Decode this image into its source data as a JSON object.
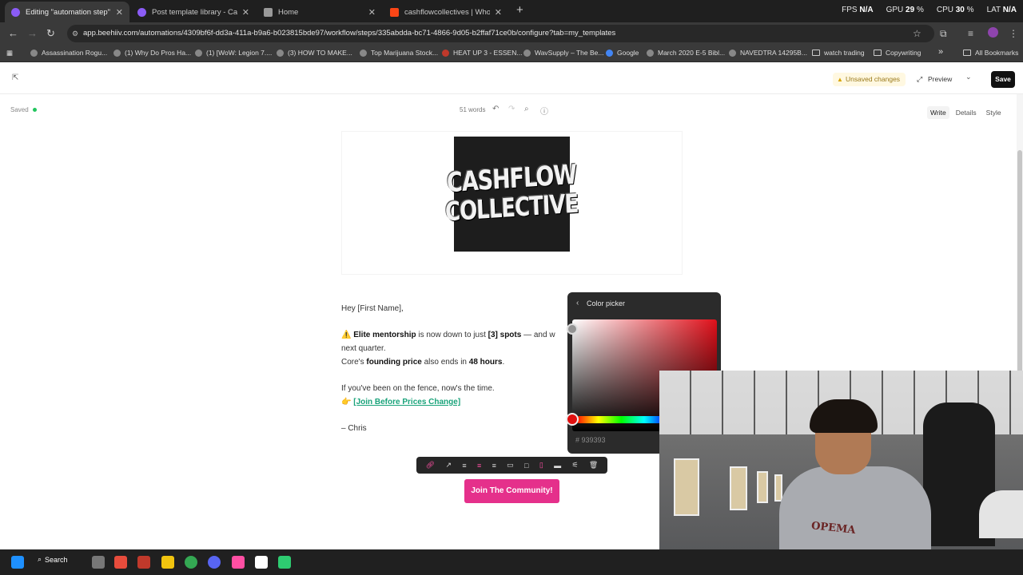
{
  "browser": {
    "tabs": [
      {
        "title": "Editing \"automation step\"",
        "active": true,
        "icon": "beehiiv-icon"
      },
      {
        "title": "Post template library - Cashflo...",
        "active": false,
        "icon": "beehiiv-icon"
      },
      {
        "title": "Home",
        "active": false,
        "icon": "page-icon"
      },
      {
        "title": "cashflowcollectives | Whop",
        "active": false,
        "icon": "whop-icon"
      }
    ],
    "new_tab": "+",
    "url": "app.beehiiv.com/automations/4309bf6f-dd3a-411a-b9a6-b023815bde97/workflow/steps/335abdda-bc71-4866-9d05-b2ffaf71ce0b/configure?tab=my_templates",
    "perf": {
      "fps_label": "FPS",
      "fps": "N/A",
      "gpu_label": "GPU",
      "gpu": "29",
      "cpu_label": "CPU",
      "cpu": "30",
      "lat_label": "LAT",
      "lat": "N/A",
      "pct": "%"
    },
    "bookmarks": [
      "Assassination Rogu...",
      "(1) Why Do Pros Ha...",
      "(1) [WoW: Legion 7....",
      "(3) HOW TO MAKE...",
      "Top Marijuana Stock...",
      "HEAT UP 3 - ESSEN...",
      "WavSupply – The Be...",
      "Google",
      "March 2020 E-5 Bibl...",
      "NAVEDTRA 14295B...",
      "watch trading",
      "Copywriting"
    ],
    "bookmarks_more": "»",
    "all_bookmarks": "All Bookmarks"
  },
  "toolbar": {
    "unsaved": "Unsaved changes",
    "preview": "Preview",
    "save": "Save"
  },
  "editor": {
    "saved": "Saved",
    "words": "51 words",
    "pane_tabs": [
      "Write",
      "Details",
      "Style"
    ],
    "logo": {
      "line1": "CASHFLOW",
      "line2": "COLLECTIVE"
    },
    "greeting": "Hey [First Name],",
    "line1_emoji": "⚠️",
    "line1_b1": "Elite mentorship",
    "line1_t1": " is now down to just ",
    "line1_b2": "[3] spots",
    "line1_t2": " — and w",
    "line2": "next quarter.",
    "line3_t1": "Core's ",
    "line3_b1": "founding price",
    "line3_t2": " also ends in ",
    "line3_b2": "48 hours",
    "line3_t3": ".",
    "line4": "If you've been on the fence, now's the time.",
    "line5_emoji": "👉",
    "line5_link": "[Join Before Prices Change]",
    "signoff": "– Chris",
    "cta": "Join The Community!"
  },
  "color_picker": {
    "title": "Color picker",
    "hex_prefix": "#",
    "hex": "939393",
    "selected_color": "#939393",
    "hue_color": "#e0101a"
  },
  "webcam": {
    "shirt_text": "OPEMA"
  },
  "taskbar": {
    "search": "Search"
  },
  "colors": {
    "accent": "#e5308b",
    "link": "#19a37a",
    "saved_dot": "#22c55e"
  }
}
